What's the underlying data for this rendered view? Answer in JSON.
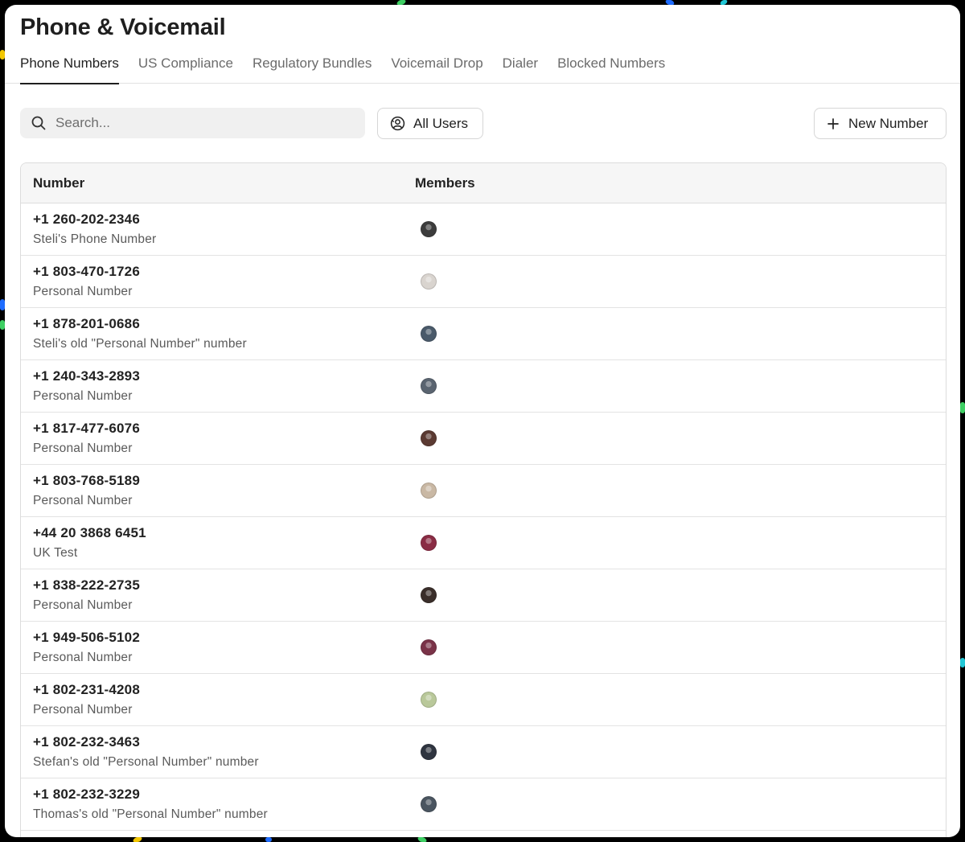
{
  "page": {
    "title": "Phone & Voicemail"
  },
  "tabs": [
    {
      "label": "Phone Numbers",
      "active": true
    },
    {
      "label": "US Compliance",
      "active": false
    },
    {
      "label": "Regulatory Bundles",
      "active": false
    },
    {
      "label": "Voicemail Drop",
      "active": false
    },
    {
      "label": "Dialer",
      "active": false
    },
    {
      "label": "Blocked Numbers",
      "active": false
    }
  ],
  "toolbar": {
    "search_placeholder": "Search...",
    "search_value": "",
    "users_filter_label": "All Users",
    "new_number_label": "New Number"
  },
  "table": {
    "columns": [
      "Number",
      "Members"
    ],
    "rows": [
      {
        "number": "+1 260-202-2346",
        "label": "Steli's Phone Number",
        "avatar_color": "#3c3c3c"
      },
      {
        "number": "+1 803-470-1726",
        "label": "Personal Number",
        "avatar_color": "#d9d4cf"
      },
      {
        "number": "+1 878-201-0686",
        "label": "Steli's old \"Personal Number\" number",
        "avatar_color": "#4a5a6a"
      },
      {
        "number": "+1 240-343-2893",
        "label": "Personal Number",
        "avatar_color": "#5a6470"
      },
      {
        "number": "+1 817-477-6076",
        "label": "Personal Number",
        "avatar_color": "#5b3a32"
      },
      {
        "number": "+1 803-768-5189",
        "label": "Personal Number",
        "avatar_color": "#c9b8a4"
      },
      {
        "number": "+44 20 3868 6451",
        "label": "UK Test",
        "avatar_color": "#8a2c44"
      },
      {
        "number": "+1 838-222-2735",
        "label": "Personal Number",
        "avatar_color": "#3a2e2a"
      },
      {
        "number": "+1 949-506-5102",
        "label": "Personal Number",
        "avatar_color": "#7a3348"
      },
      {
        "number": "+1 802-231-4208",
        "label": "Personal Number",
        "avatar_color": "#b9c89a"
      },
      {
        "number": "+1 802-232-3463",
        "label": "Stefan's old \"Personal Number\" number",
        "avatar_color": "#2f3540"
      },
      {
        "number": "+1 802-232-3229",
        "label": "Thomas's old \"Personal Number\" number",
        "avatar_color": "#4a5560"
      }
    ]
  }
}
